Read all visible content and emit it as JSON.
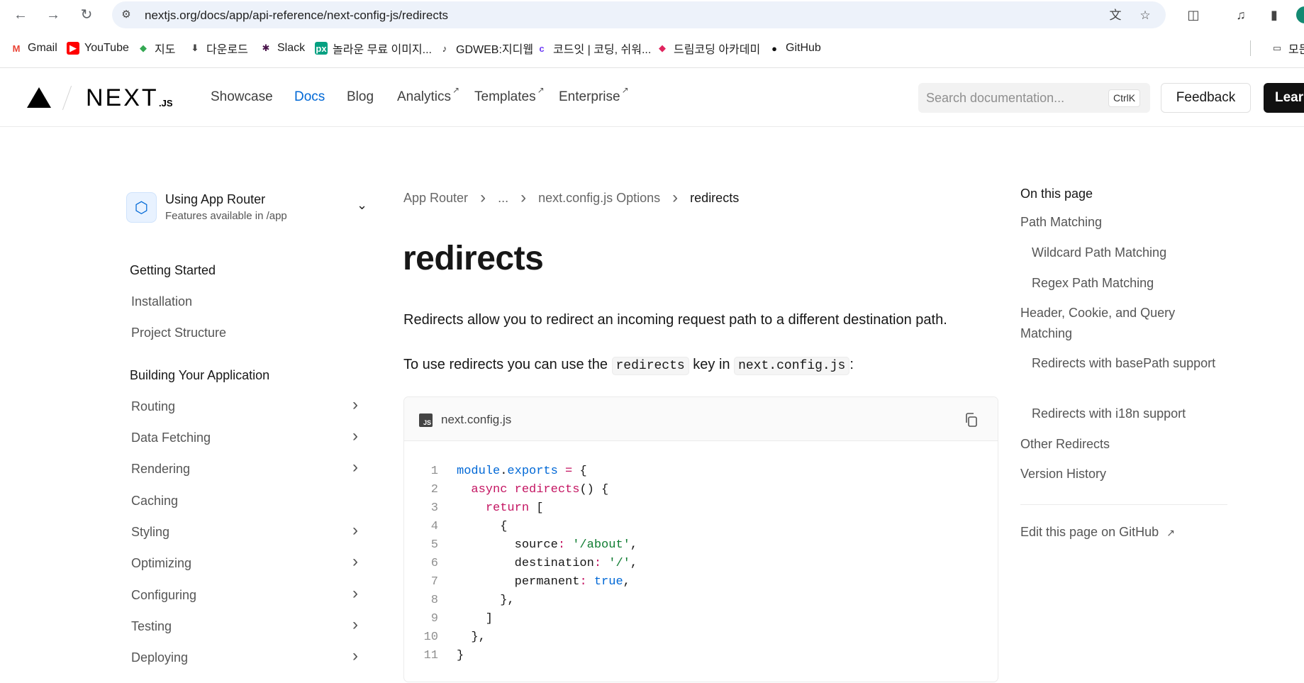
{
  "browser": {
    "url": "nextjs.org/docs/app/api-reference/next-config-js/redirects",
    "bookmarks": [
      {
        "label": "Gmail",
        "icon": "gmail-icon",
        "color": "#ea4335"
      },
      {
        "label": "YouTube",
        "icon": "youtube-icon",
        "color": "#ff0000"
      },
      {
        "label": "지도",
        "icon": "maps-icon",
        "color": "#34a853"
      },
      {
        "label": "다운로드",
        "icon": "download-icon",
        "color": "#444444"
      },
      {
        "label": "Slack",
        "icon": "slack-icon",
        "color": "#4a154b"
      },
      {
        "label": "놀라운 무료 이미지...",
        "icon": "pexels-icon",
        "color": "#05a081"
      },
      {
        "label": "GDWEB:지디웹",
        "icon": "gdweb-icon",
        "color": "#111111"
      },
      {
        "label": "코드잇 | 코딩, 쉬워...",
        "icon": "codeit-icon",
        "color": "#6e3cf5"
      },
      {
        "label": "드림코딩 아카데미",
        "icon": "dreamcoding-icon",
        "color": "#e0245e"
      },
      {
        "label": "GitHub",
        "icon": "github-icon",
        "color": "#111111"
      },
      {
        "label": "모든",
        "icon": "folder-icon",
        "color": "#444444"
      }
    ]
  },
  "header": {
    "logo_text": "NEXT",
    "logo_suffix": ".JS",
    "nav": [
      {
        "label": "Showcase",
        "external": false,
        "active": false
      },
      {
        "label": "Docs",
        "external": false,
        "active": true
      },
      {
        "label": "Blog",
        "external": false,
        "active": false
      },
      {
        "label": "Analytics",
        "external": true,
        "active": false
      },
      {
        "label": "Templates",
        "external": true,
        "active": false
      },
      {
        "label": "Enterprise",
        "external": true,
        "active": false
      }
    ],
    "external_glyph": "↗",
    "search_placeholder": "Search documentation...",
    "search_shortcut": "CtrlK",
    "feedback_label": "Feedback",
    "learn_label": "Learn"
  },
  "sidebar": {
    "router_title": "Using App Router",
    "router_subtitle": "Features available in /app",
    "sections": [
      {
        "heading": "Getting Started",
        "items": [
          {
            "label": "Installation",
            "expandable": false
          },
          {
            "label": "Project Structure",
            "expandable": false
          }
        ]
      },
      {
        "heading": "Building Your Application",
        "items": [
          {
            "label": "Routing",
            "expandable": true
          },
          {
            "label": "Data Fetching",
            "expandable": true
          },
          {
            "label": "Rendering",
            "expandable": true
          },
          {
            "label": "Caching",
            "expandable": false
          },
          {
            "label": "Styling",
            "expandable": true
          },
          {
            "label": "Optimizing",
            "expandable": true
          },
          {
            "label": "Configuring",
            "expandable": true
          },
          {
            "label": "Testing",
            "expandable": true
          },
          {
            "label": "Deploying",
            "expandable": true
          }
        ]
      }
    ]
  },
  "main": {
    "breadcrumbs": [
      "App Router",
      "...",
      "next.config.js Options",
      "redirects"
    ],
    "title": "redirects",
    "intro": "Redirects allow you to redirect an incoming request path to a different destination path.",
    "usage_prefix": "To use redirects you can use the ",
    "usage_code1": "redirects",
    "usage_middle": " key in ",
    "usage_code2": "next.config.js",
    "usage_suffix": ":",
    "code": {
      "filename": "next.config.js",
      "badge": "JS",
      "lines": [
        [
          {
            "t": "module",
            "c": "blue"
          },
          {
            "t": ".",
            "c": "plain"
          },
          {
            "t": "exports",
            "c": "blue"
          },
          {
            "t": " ",
            "c": "plain"
          },
          {
            "t": "=",
            "c": "pink"
          },
          {
            "t": " {",
            "c": "plain"
          }
        ],
        [
          {
            "t": "  ",
            "c": "plain"
          },
          {
            "t": "async",
            "c": "pink"
          },
          {
            "t": " ",
            "c": "plain"
          },
          {
            "t": "redirects",
            "c": "pink"
          },
          {
            "t": "() {",
            "c": "plain"
          }
        ],
        [
          {
            "t": "    ",
            "c": "plain"
          },
          {
            "t": "return",
            "c": "pink"
          },
          {
            "t": " [",
            "c": "plain"
          }
        ],
        [
          {
            "t": "      {",
            "c": "plain"
          }
        ],
        [
          {
            "t": "        source",
            "c": "plain"
          },
          {
            "t": ":",
            "c": "pink"
          },
          {
            "t": " ",
            "c": "plain"
          },
          {
            "t": "'/about'",
            "c": "green"
          },
          {
            "t": ",",
            "c": "plain"
          }
        ],
        [
          {
            "t": "        destination",
            "c": "plain"
          },
          {
            "t": ":",
            "c": "pink"
          },
          {
            "t": " ",
            "c": "plain"
          },
          {
            "t": "'/'",
            "c": "green"
          },
          {
            "t": ",",
            "c": "plain"
          }
        ],
        [
          {
            "t": "        permanent",
            "c": "plain"
          },
          {
            "t": ":",
            "c": "pink"
          },
          {
            "t": " ",
            "c": "plain"
          },
          {
            "t": "true",
            "c": "blue"
          },
          {
            "t": ",",
            "c": "plain"
          }
        ],
        [
          {
            "t": "      },",
            "c": "plain"
          }
        ],
        [
          {
            "t": "    ]",
            "c": "plain"
          }
        ],
        [
          {
            "t": "  },",
            "c": "plain"
          }
        ],
        [
          {
            "t": "}",
            "c": "plain"
          }
        ]
      ]
    }
  },
  "toc": {
    "title": "On this page",
    "items": [
      {
        "label": "Path Matching",
        "level": 1
      },
      {
        "label": "Wildcard Path Matching",
        "level": 2
      },
      {
        "label": "Regex Path Matching",
        "level": 2
      },
      {
        "label": "Header, Cookie, and Query Matching",
        "level": 1
      },
      {
        "label": "Redirects with basePath support",
        "level": 2
      },
      {
        "label": "Redirects with i18n support",
        "level": 2
      },
      {
        "label": "Other Redirects",
        "level": 1
      },
      {
        "label": "Version History",
        "level": 1
      }
    ],
    "edit_label": "Edit this page on GitHub",
    "edit_glyph": "↗"
  },
  "colors": {
    "accent": "#0068d6",
    "keyword": "#c41562",
    "string": "#107d32"
  }
}
